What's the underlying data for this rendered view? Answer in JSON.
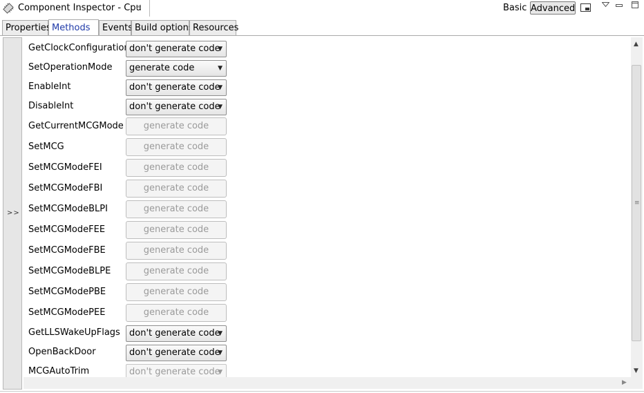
{
  "window": {
    "title": "Component Inspector - Cpu",
    "close_glyph": "⨯",
    "mode_basic": "Basic",
    "mode_advanced": "Advanced"
  },
  "tabs": [
    {
      "label": "Properties"
    },
    {
      "label": "Methods"
    },
    {
      "label": "Events"
    },
    {
      "label": "Build options"
    },
    {
      "label": "Resources"
    }
  ],
  "left_bar": {
    "expand_label": ">>"
  },
  "methods": [
    {
      "name": "GetClockConfiguration",
      "value": "don't generate code",
      "state": "enabled"
    },
    {
      "name": "SetOperationMode",
      "value": "generate code",
      "state": "enabled"
    },
    {
      "name": "EnableInt",
      "value": "don't generate code",
      "state": "enabled"
    },
    {
      "name": "DisableInt",
      "value": "don't generate code",
      "state": "enabled"
    },
    {
      "name": "GetCurrentMCGMode",
      "value": "generate code",
      "state": "disabled"
    },
    {
      "name": "SetMCG",
      "value": "generate code",
      "state": "disabled"
    },
    {
      "name": "SetMCGModeFEI",
      "value": "generate code",
      "state": "disabled"
    },
    {
      "name": "SetMCGModeFBI",
      "value": "generate code",
      "state": "disabled"
    },
    {
      "name": "SetMCGModeBLPI",
      "value": "generate code",
      "state": "disabled"
    },
    {
      "name": "SetMCGModeFEE",
      "value": "generate code",
      "state": "disabled"
    },
    {
      "name": "SetMCGModeFBE",
      "value": "generate code",
      "state": "disabled"
    },
    {
      "name": "SetMCGModeBLPE",
      "value": "generate code",
      "state": "disabled"
    },
    {
      "name": "SetMCGModePBE",
      "value": "generate code",
      "state": "disabled"
    },
    {
      "name": "SetMCGModePEE",
      "value": "generate code",
      "state": "disabled"
    },
    {
      "name": "GetLLSWakeUpFlags",
      "value": "don't generate code",
      "state": "enabled"
    },
    {
      "name": "OpenBackDoor",
      "value": "don't generate code",
      "state": "enabled"
    },
    {
      "name": "MCGAutoTrim",
      "value": "don't generate code",
      "state": "disabled-select"
    }
  ],
  "icons": {
    "app": "component-chip-icon",
    "layout": "layout-toggle-icon",
    "view_menu": "view-menu-icon",
    "minimize": "minimize-icon",
    "maximize": "maximize-icon"
  }
}
